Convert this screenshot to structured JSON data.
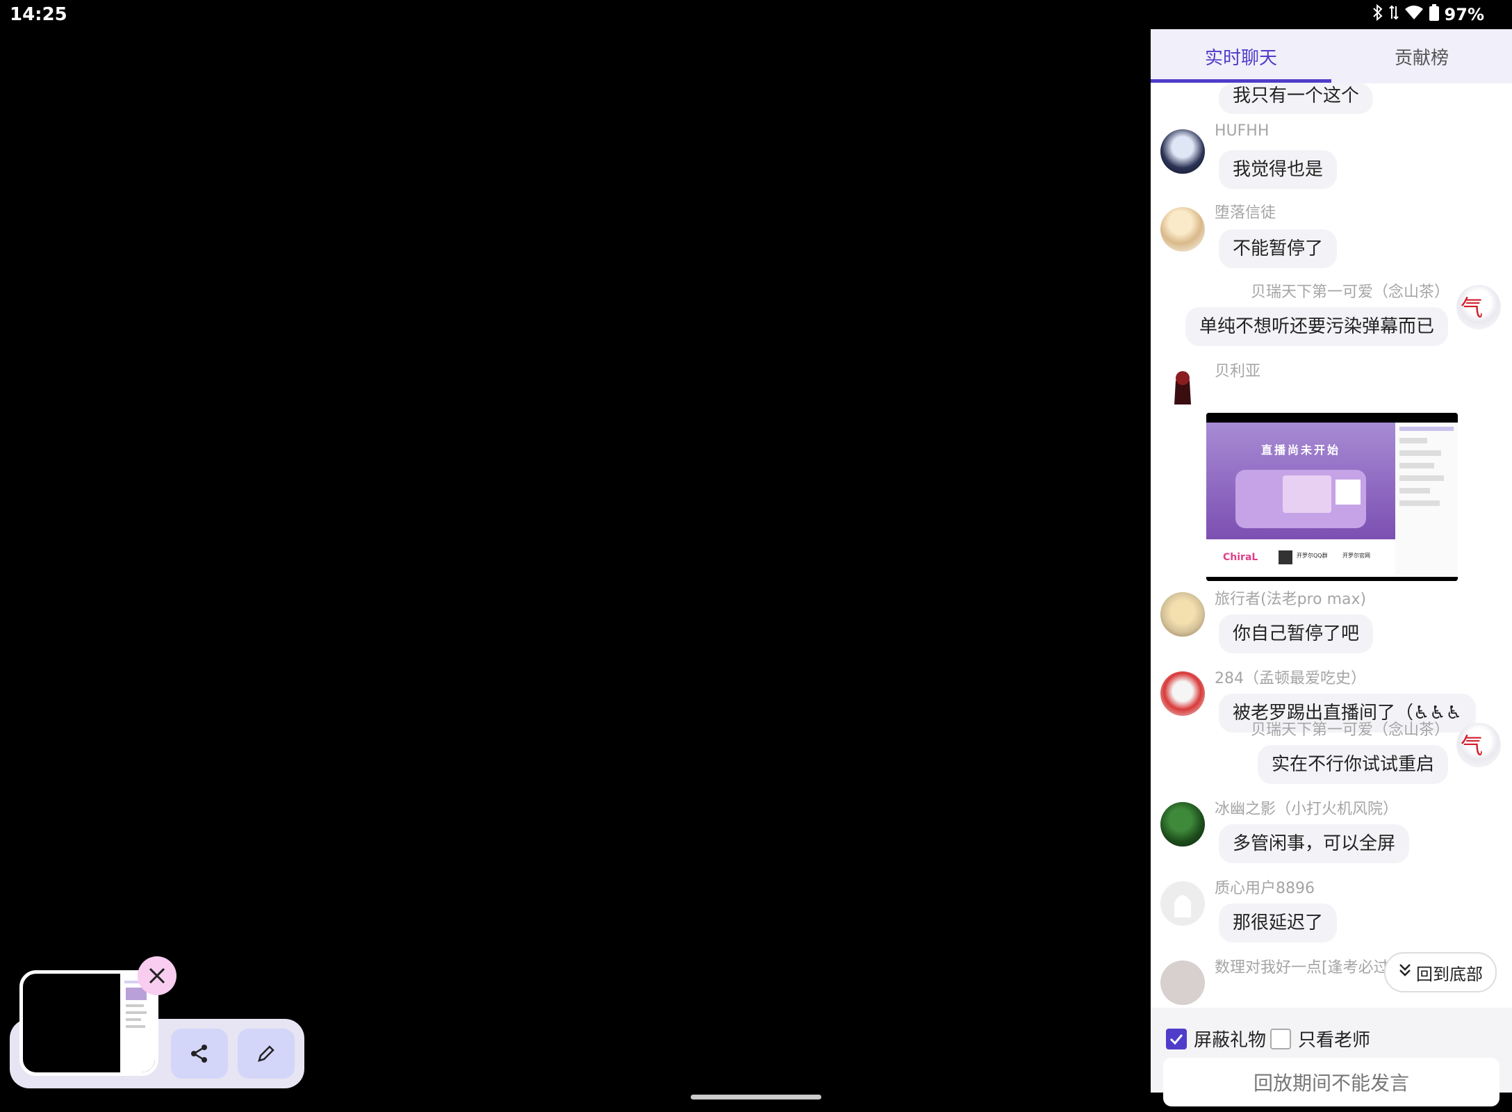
{
  "status_bar": {
    "time": "14:25",
    "battery": "97%"
  },
  "tabs": [
    {
      "label": "实时聊天",
      "active": true
    },
    {
      "label": "贡献榜",
      "active": false
    }
  ],
  "messages": [
    {
      "user": "",
      "text": "我只有一个这个",
      "side": "left"
    },
    {
      "user": "HUFHH",
      "text": "我觉得也是",
      "side": "left"
    },
    {
      "user": "堕落信徒",
      "text": "不能暂停了",
      "side": "left"
    },
    {
      "user": "贝瑞天下第一可爱（念山茶）",
      "text": "单纯不想听还要污染弹幕而已",
      "side": "right"
    },
    {
      "user": "贝利亚",
      "image": true,
      "image_text": {
        "title": "直播尚未开始",
        "brand": "ChiraL",
        "qq": "开罗尔QQ群",
        "site": "开罗尔官网"
      }
    },
    {
      "user": "旅行者(法老pro max)",
      "text": "你自己暂停了吧",
      "side": "left"
    },
    {
      "user": "284（孟顿最爱吃史）",
      "text": "被老罗踢出直播间了（♿♿♿",
      "side": "left"
    },
    {
      "user": "贝瑞天下第一可爱（念山茶）",
      "text": "实在不行你试试重启",
      "side": "right"
    },
    {
      "user": "冰幽之影（小打火机风院）",
      "text": "多管闲事，可以全屏",
      "side": "left"
    },
    {
      "user": "质心用户8896",
      "text": "那很延迟了",
      "side": "left"
    },
    {
      "user": "数理对我好一点[逢考必过]摇光",
      "text": "",
      "side": "left"
    }
  ],
  "back_to_bottom": "回到底部",
  "filters": {
    "block_gifts": "屏蔽礼物",
    "block_gifts_checked": true,
    "teacher_only": "只看老师",
    "teacher_only_checked": false
  },
  "input_placeholder": "回放期间不能发言",
  "colors": {
    "accent": "#4f3cc9",
    "bubble": "#f3f3f7",
    "background": "#000000"
  }
}
